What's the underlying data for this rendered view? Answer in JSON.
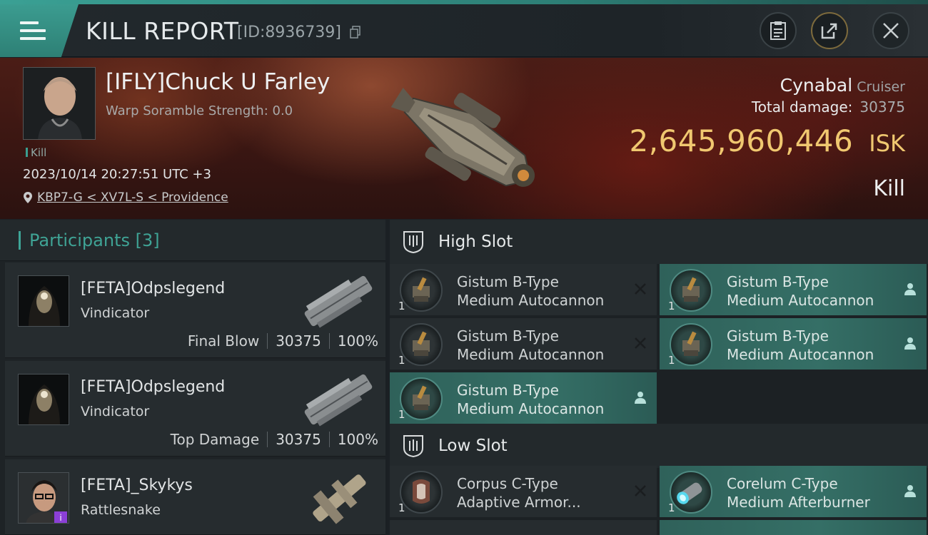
{
  "header": {
    "title": "KILL REPORT",
    "report_id": "[ID:8936739]",
    "icons": [
      "menu-icon",
      "copy-icon",
      "clipboard-icon",
      "share-icon",
      "close-icon"
    ]
  },
  "victim": {
    "name": "[IFLY]Chuck U Farley",
    "scramble": "Warp Soramble Strength: 0.0",
    "tag": "Kill",
    "datetime": "2023/10/14 20:27:51 UTC +3",
    "location": "KBP7-G < XV7L-S < Providence",
    "ship_name": "Cynabal",
    "ship_class": "Cruiser",
    "total_damage_label": "Total damage:",
    "total_damage_value": "30375",
    "isk_value": "2,645,960,446",
    "isk_unit": "ISK",
    "result": "Kill"
  },
  "participants": {
    "title": "Participants [3]",
    "list": [
      {
        "name": "[FETA]Odpslegend",
        "ship": "Vindicator",
        "label": "Final Blow",
        "damage": "30375",
        "percent": "100%"
      },
      {
        "name": "[FETA]Odpslegend",
        "ship": "Vindicator",
        "label": "Top Damage",
        "damage": "30375",
        "percent": "100%"
      },
      {
        "name": "[FETA]_Skykys",
        "ship": "Rattlesnake",
        "badge": "i"
      }
    ]
  },
  "slots": {
    "high": {
      "title": "High Slot",
      "modules": [
        {
          "line1": "Gistum B-Type",
          "line2": "Medium Autocannon",
          "qty": "1",
          "status": "destroyed"
        },
        {
          "line1": "Gistum B-Type",
          "line2": "Medium Autocannon",
          "qty": "1",
          "status": "dropped"
        },
        {
          "line1": "Gistum B-Type",
          "line2": "Medium Autocannon",
          "qty": "1",
          "status": "destroyed"
        },
        {
          "line1": "Gistum B-Type",
          "line2": "Medium Autocannon",
          "qty": "1",
          "status": "dropped"
        },
        {
          "line1": "Gistum B-Type",
          "line2": "Medium Autocannon",
          "qty": "1",
          "status": "dropped"
        }
      ]
    },
    "low": {
      "title": "Low Slot",
      "modules": [
        {
          "line1": "Corpus C-Type",
          "line2": "Adaptive Armor...",
          "qty": "1",
          "status": "destroyed"
        },
        {
          "line1": "Corelum C-Type",
          "line2": "Medium Afterburner",
          "qty": "1",
          "status": "dropped"
        }
      ]
    }
  },
  "colors": {
    "accent": "#3ea597",
    "isk": "#f0c870",
    "dropped_bg": "#356f66"
  }
}
